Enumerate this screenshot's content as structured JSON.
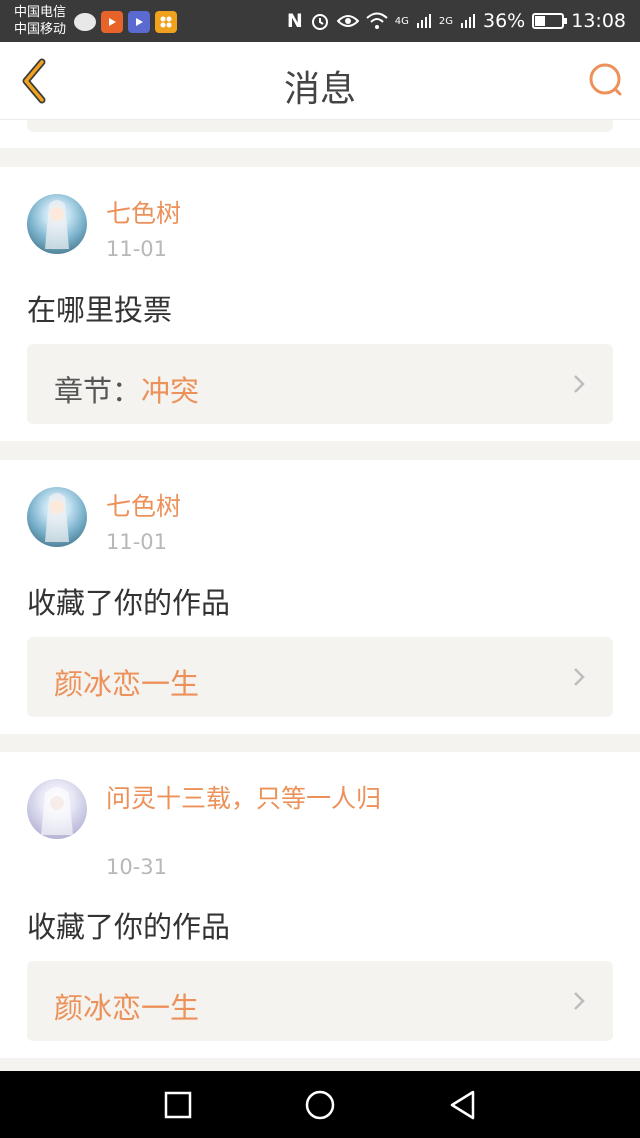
{
  "status_bar": {
    "carrier_1": "中国电信",
    "carrier_2": "中国移动",
    "nfc": "N",
    "network_4g": "4G",
    "network_2g": "2G",
    "battery_text": "36%",
    "battery_level": 0.36,
    "time": "13:08"
  },
  "header": {
    "title": "消息",
    "accent_color": "#f0a21f",
    "search_color": "#ec915a"
  },
  "cards": [
    {
      "username": "七色树",
      "date": "11-01",
      "message": "在哪里投票",
      "ref_prefix": "章节：",
      "ref_title": "冲突"
    },
    {
      "username": "七色树",
      "date": "11-01",
      "message": "收藏了你的作品",
      "ref_prefix": "",
      "ref_title": "颜冰恋一生"
    },
    {
      "username": "问灵十三载，只等一人归",
      "date": "10-31",
      "message": "收藏了你的作品",
      "ref_prefix": "",
      "ref_title": "颜冰恋一生"
    }
  ],
  "icons": {
    "back": "chevron-left-icon",
    "search": "search-icon",
    "nav_recents": "square-icon",
    "nav_home": "circle-icon",
    "nav_back": "triangle-back-icon"
  }
}
